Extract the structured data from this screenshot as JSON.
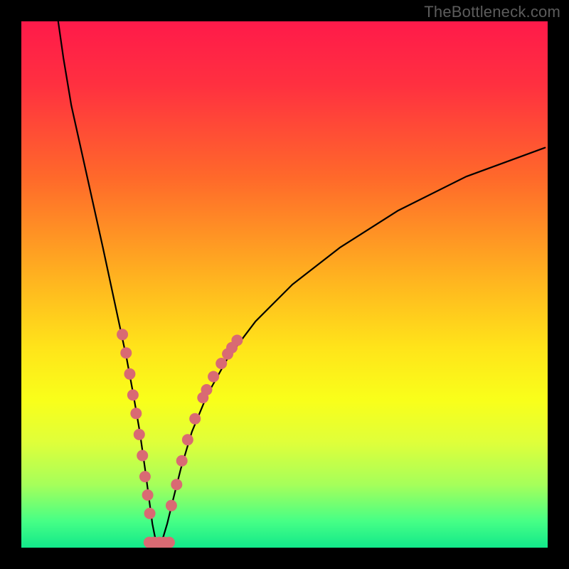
{
  "watermark": "TheBottleneck.com",
  "chart_data": {
    "type": "line",
    "title": "",
    "xlabel": "",
    "ylabel": "",
    "xlim": [
      0,
      100
    ],
    "ylim": [
      0,
      100
    ],
    "background_gradient_stops": [
      {
        "offset": 0.0,
        "color": "#ff1a4a"
      },
      {
        "offset": 0.12,
        "color": "#ff3040"
      },
      {
        "offset": 0.3,
        "color": "#ff6a2a"
      },
      {
        "offset": 0.48,
        "color": "#ffb020"
      },
      {
        "offset": 0.62,
        "color": "#ffe41a"
      },
      {
        "offset": 0.72,
        "color": "#f9ff1a"
      },
      {
        "offset": 0.8,
        "color": "#dfff3a"
      },
      {
        "offset": 0.88,
        "color": "#a6ff5a"
      },
      {
        "offset": 0.95,
        "color": "#46ff86"
      },
      {
        "offset": 1.0,
        "color": "#12e88a"
      }
    ],
    "series": [
      {
        "name": "bottleneck-curve",
        "x": [
          7.0,
          8.0,
          9.5,
          11.5,
          13.5,
          15.5,
          17.0,
          18.5,
          20.0,
          21.3,
          22.5,
          23.5,
          24.3,
          24.9,
          25.5,
          26.1,
          26.8,
          27.7,
          28.8,
          30.3,
          32.4,
          35.3,
          39.2,
          44.5,
          51.5,
          60.5,
          71.5,
          84.5,
          99.5
        ],
        "y": [
          100,
          93.0,
          84.0,
          75.0,
          66.0,
          57.0,
          50.0,
          43.0,
          36.0,
          29.0,
          22.0,
          15.0,
          9.0,
          4.5,
          1.5,
          0.4,
          1.5,
          4.5,
          9.0,
          15.0,
          22.0,
          29.0,
          36.0,
          43.0,
          50.0,
          57.0,
          64.0,
          70.5,
          76.0
        ]
      }
    ],
    "scatter_points": {
      "color": "#d96a73",
      "radius": 8,
      "points": [
        {
          "x": 19.2,
          "y": 40.5
        },
        {
          "x": 19.9,
          "y": 37.0
        },
        {
          "x": 20.6,
          "y": 33.0
        },
        {
          "x": 21.2,
          "y": 29.0
        },
        {
          "x": 21.8,
          "y": 25.5
        },
        {
          "x": 22.4,
          "y": 21.5
        },
        {
          "x": 23.0,
          "y": 17.5
        },
        {
          "x": 23.5,
          "y": 13.5
        },
        {
          "x": 24.0,
          "y": 10.0
        },
        {
          "x": 24.4,
          "y": 6.5
        },
        {
          "x": 24.3,
          "y": 1.0
        },
        {
          "x": 25.2,
          "y": 1.0
        },
        {
          "x": 26.2,
          "y": 1.0
        },
        {
          "x": 27.2,
          "y": 1.0
        },
        {
          "x": 28.1,
          "y": 1.0
        },
        {
          "x": 28.5,
          "y": 8.0
        },
        {
          "x": 29.5,
          "y": 12.0
        },
        {
          "x": 30.5,
          "y": 16.5
        },
        {
          "x": 31.6,
          "y": 20.5
        },
        {
          "x": 33.0,
          "y": 24.5
        },
        {
          "x": 34.5,
          "y": 28.5
        },
        {
          "x": 35.2,
          "y": 30.0
        },
        {
          "x": 36.5,
          "y": 32.5
        },
        {
          "x": 38.0,
          "y": 35.0
        },
        {
          "x": 39.2,
          "y": 36.8
        },
        {
          "x": 40.0,
          "y": 38.0
        },
        {
          "x": 41.0,
          "y": 39.4
        }
      ]
    }
  }
}
